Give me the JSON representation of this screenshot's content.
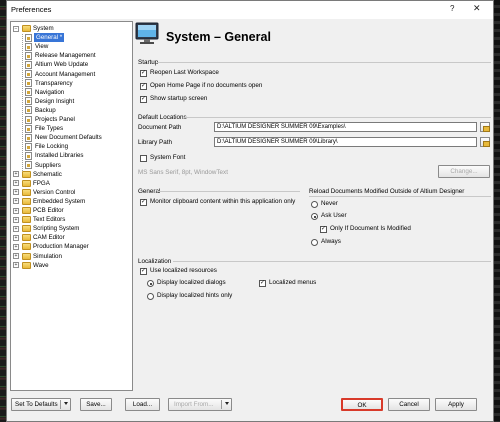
{
  "window": {
    "title": "Preferences",
    "help": "?",
    "close": "✕"
  },
  "tree": {
    "items": [
      {
        "label": "System",
        "level": 0,
        "kind": "folder",
        "expander": "−"
      },
      {
        "label": "General *",
        "level": 1,
        "kind": "page",
        "selected": true
      },
      {
        "label": "View",
        "level": 1,
        "kind": "page"
      },
      {
        "label": "Release Management",
        "level": 1,
        "kind": "page"
      },
      {
        "label": "Altium Web Update",
        "level": 1,
        "kind": "page"
      },
      {
        "label": "Account Management",
        "level": 1,
        "kind": "page"
      },
      {
        "label": "Transparency",
        "level": 1,
        "kind": "page"
      },
      {
        "label": "Navigation",
        "level": 1,
        "kind": "page"
      },
      {
        "label": "Design Insight",
        "level": 1,
        "kind": "page"
      },
      {
        "label": "Backup",
        "level": 1,
        "kind": "page"
      },
      {
        "label": "Projects Panel",
        "level": 1,
        "kind": "page"
      },
      {
        "label": "File Types",
        "level": 1,
        "kind": "page"
      },
      {
        "label": "New Document Defaults",
        "level": 1,
        "kind": "page"
      },
      {
        "label": "File Locking",
        "level": 1,
        "kind": "page"
      },
      {
        "label": "Installed Libraries",
        "level": 1,
        "kind": "page"
      },
      {
        "label": "Suppliers",
        "level": 1,
        "kind": "page"
      },
      {
        "label": "Schematic",
        "level": 0,
        "kind": "folder",
        "expander": "+"
      },
      {
        "label": "FPGA",
        "level": 0,
        "kind": "folder",
        "expander": "+"
      },
      {
        "label": "Version Control",
        "level": 0,
        "kind": "folder",
        "expander": "+"
      },
      {
        "label": "Embedded System",
        "level": 0,
        "kind": "folder",
        "expander": "+"
      },
      {
        "label": "PCB Editor",
        "level": 0,
        "kind": "folder",
        "expander": "+"
      },
      {
        "label": "Text Editors",
        "level": 0,
        "kind": "folder",
        "expander": "+"
      },
      {
        "label": "Scripting System",
        "level": 0,
        "kind": "folder",
        "expander": "+"
      },
      {
        "label": "CAM Editor",
        "level": 0,
        "kind": "folder",
        "expander": "+"
      },
      {
        "label": "Production Manager",
        "level": 0,
        "kind": "folder",
        "expander": "+"
      },
      {
        "label": "Simulation",
        "level": 0,
        "kind": "folder",
        "expander": "+"
      },
      {
        "label": "Wave",
        "level": 0,
        "kind": "folder",
        "expander": "+"
      }
    ]
  },
  "header": {
    "title": "System – General",
    "icon": "monitor-icon"
  },
  "startup": {
    "section": "Startup",
    "reopen_last_workspace": {
      "label": "Reopen Last Workspace",
      "checked": true
    },
    "open_home_page": {
      "label": "Open Home Page if no documents open",
      "checked": true
    },
    "show_startup_screen": {
      "label": "Show startup screen",
      "checked": true
    }
  },
  "default_locations": {
    "section": "Default Locations",
    "document_path_label": "Document Path",
    "document_path_value": "D:\\ALTIUM DESIGNER SUMMER 09\\Examples\\",
    "library_path_label": "Library Path",
    "library_path_value": "D:\\ALTIUM DESIGNER SUMMER 09\\Library\\"
  },
  "system_font": {
    "label": "System Font",
    "checked": false,
    "font_value": "MS Sans Serif, 8pt, WindowText",
    "change_button": "Change..."
  },
  "general": {
    "section": "General",
    "monitor_clipboard": {
      "label": "Monitor clipboard content within this application only",
      "checked": true
    }
  },
  "reload": {
    "section": "Reload Documents Modified Outside of Altium Designer",
    "never": "Never",
    "ask_user": "Ask User",
    "only_if_modified": "Only If Document Is Modified",
    "always": "Always",
    "selected": "Ask User",
    "only_if_modified_checked": true
  },
  "localization": {
    "section": "Localization",
    "use_localized": {
      "label": "Use localized resources",
      "checked": true
    },
    "display_dialogs": "Display localized dialogs",
    "display_hints": "Display localized hints only",
    "localized_menus": {
      "label": "Localized menus",
      "checked": true
    },
    "selected": "Display localized dialogs"
  },
  "footer": {
    "set_to_defaults": "Set To Defaults",
    "save": "Save...",
    "load": "Load...",
    "import_from": "Import From...",
    "ok": "OK",
    "cancel": "Cancel",
    "apply": "Apply"
  },
  "colors": {
    "selection": "#3875d7",
    "dialog_bg": "#f0f0f0",
    "folder": "#e8b93a"
  }
}
